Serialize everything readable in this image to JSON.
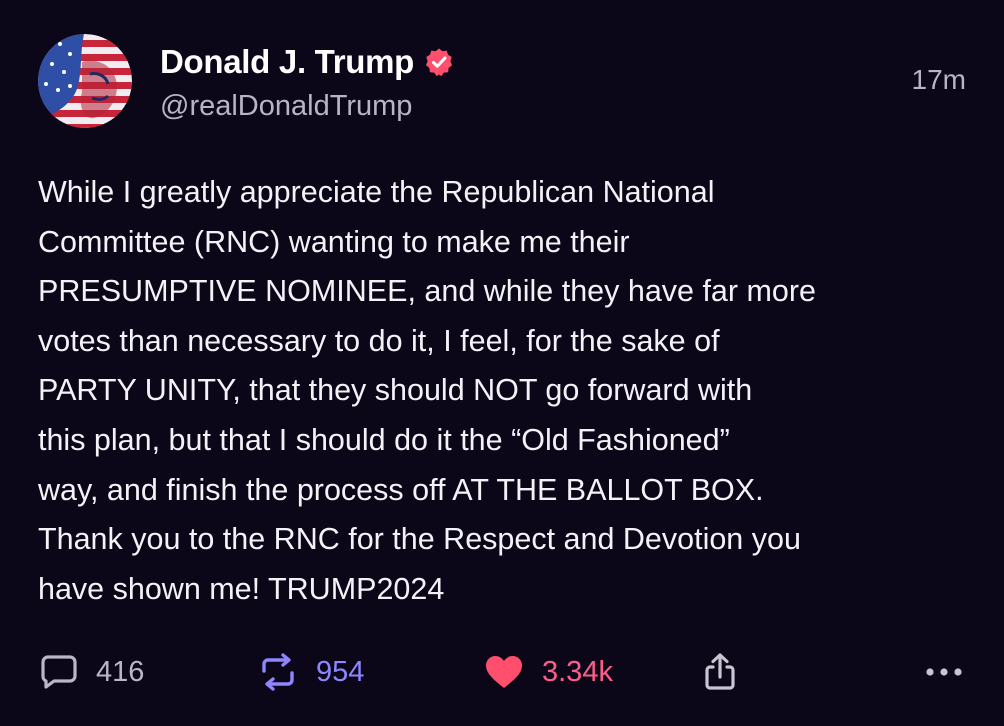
{
  "author": {
    "display_name": "Donald J. Trump",
    "handle": "@realDonaldTrump",
    "verified_color": "#ff4f6d"
  },
  "post": {
    "timestamp": "17m",
    "text_lines": [
      "While I greatly appreciate the Republican National",
      "Committee (RNC) wanting to make me their",
      "PRESUMPTIVE NOMINEE, and while they have far more",
      "votes than necessary to do it, I feel, for the sake of",
      "PARTY UNITY, that they should NOT go forward with",
      "this plan, but that I should do it the “Old Fashioned”",
      "way, and finish the process off AT THE BALLOT BOX.",
      "Thank you to the RNC for the Respect and Devotion you",
      "have shown me! TRUMP2024"
    ]
  },
  "actions": {
    "reply_count": "416",
    "repost_count": "954",
    "like_count": "3.34k",
    "icons": [
      "comment-icon",
      "repost-icon",
      "heart-icon",
      "share-icon",
      "more-icon"
    ]
  },
  "colors": {
    "background": "#0b0719",
    "text": "#f3f2f7",
    "muted": "#b7b4c3",
    "repost": "#8e86ff",
    "like": "#ff4f6d"
  }
}
